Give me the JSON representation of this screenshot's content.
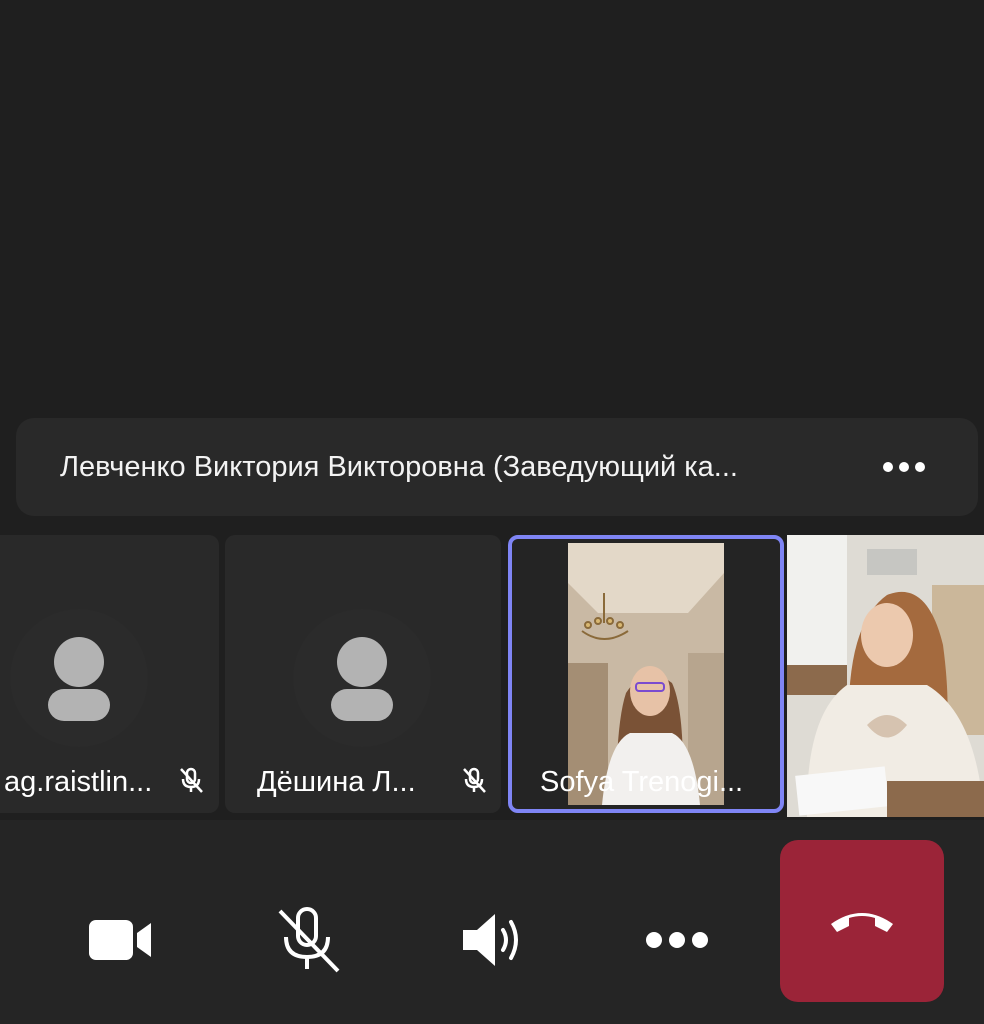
{
  "presenter": {
    "name": "Левченко Виктория Викторовна (Заведующий ка..."
  },
  "participants": [
    {
      "label": "ag.raistlin...",
      "muted": true
    },
    {
      "label": "Дёшина Л...",
      "muted": true
    },
    {
      "label": "Sofya Trenogi...",
      "muted": false,
      "active_speaker": true
    },
    {
      "label": "",
      "self_view": true
    }
  ],
  "controls": {
    "camera": "camera-icon",
    "mic": "mic-off-icon",
    "speaker": "speaker-icon",
    "more": "more-icon",
    "hangup": "hang-up-icon"
  },
  "colors": {
    "background": "#1f1f1f",
    "tile": "#292929",
    "active_border": "#7f85f5",
    "hangup": "#9b2438"
  }
}
